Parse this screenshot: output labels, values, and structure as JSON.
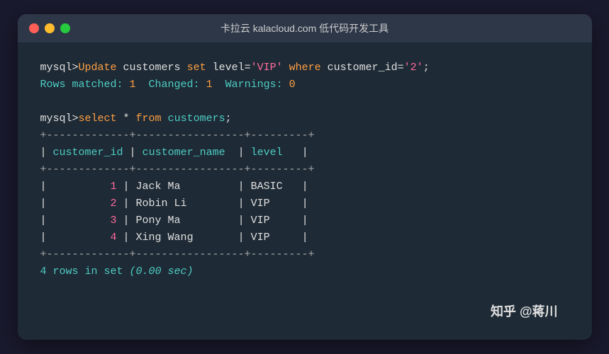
{
  "titlebar": {
    "title": "卡拉云 kalacloud.com 低代码开发工具",
    "traffic_lights": [
      {
        "color": "#ff5f56",
        "name": "close"
      },
      {
        "color": "#ffbd2e",
        "name": "minimize"
      },
      {
        "color": "#27c93f",
        "name": "maximize"
      }
    ]
  },
  "terminal": {
    "lines": [
      {
        "type": "command_update",
        "text": "mysql>Update customers set level='VIP' where customer_id='2';"
      },
      {
        "type": "result_info",
        "text": "Rows matched: 1  Changed: 1  Warnings: 0"
      },
      {
        "type": "blank"
      },
      {
        "type": "command_select",
        "text": "mysql>select * from customers;"
      },
      {
        "type": "table_border"
      },
      {
        "type": "table_header"
      },
      {
        "type": "table_border"
      },
      {
        "type": "table_row",
        "id": "1",
        "name": "Jack Ma",
        "level": "BASIC"
      },
      {
        "type": "table_row",
        "id": "2",
        "name": "Robin Li",
        "level": "VIP"
      },
      {
        "type": "table_row",
        "id": "3",
        "name": "Pony Ma",
        "level": "VIP"
      },
      {
        "type": "table_row",
        "id": "4",
        "name": "Xing Wang",
        "level": "VIP"
      },
      {
        "type": "table_border"
      },
      {
        "type": "footer",
        "text": "4 rows in set (0.00 sec)"
      }
    ],
    "watermark": "知乎 @蒋川"
  }
}
